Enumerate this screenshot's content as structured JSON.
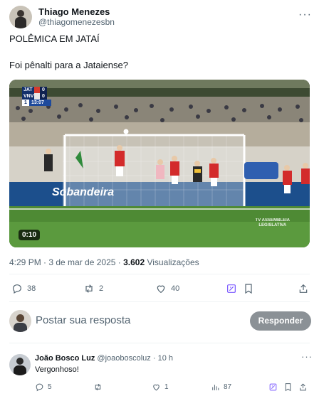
{
  "post": {
    "author_name": "Thiago Menezes",
    "author_handle": "@thiagomenezesbn",
    "line1": "POLÊMICA EM JATAÍ",
    "line2": "Foi pênalti para a Jataiense?",
    "video_duration": "0:10",
    "meta_time": "4:29 PM · 3 de mar de 2025 · ",
    "meta_views": "3.602",
    "meta_views_label": " Visualizações",
    "video_overlay": {
      "team1": "JAT",
      "score1": "0",
      "team2": "VNV",
      "score2": "0",
      "half": "1",
      "clock": "13:07",
      "ad_text": "Sobandeira",
      "watermark_line1": "TV ASSEMBLEIA",
      "watermark_line2": "LEGISLATIVA"
    },
    "actions": {
      "replies": "38",
      "reposts": "2",
      "likes": "40"
    }
  },
  "reply_box": {
    "placeholder": "Postar sua resposta",
    "button": "Responder"
  },
  "comment": {
    "name": "João Bosco Luz",
    "handle": "@joaoboscoluz",
    "time": "· 10 h",
    "text": "Vergonhoso!",
    "replies": "5",
    "likes": "1",
    "views": "87"
  },
  "colors": {
    "text": "#0f1419",
    "secondary": "#536471",
    "divider": "#eff3f4",
    "pitch": "#4e8a34"
  },
  "icons": [
    "more-icon",
    "reply-icon",
    "repost-icon",
    "like-icon",
    "grok-icon",
    "bookmark-icon",
    "share-icon",
    "views-icon"
  ]
}
